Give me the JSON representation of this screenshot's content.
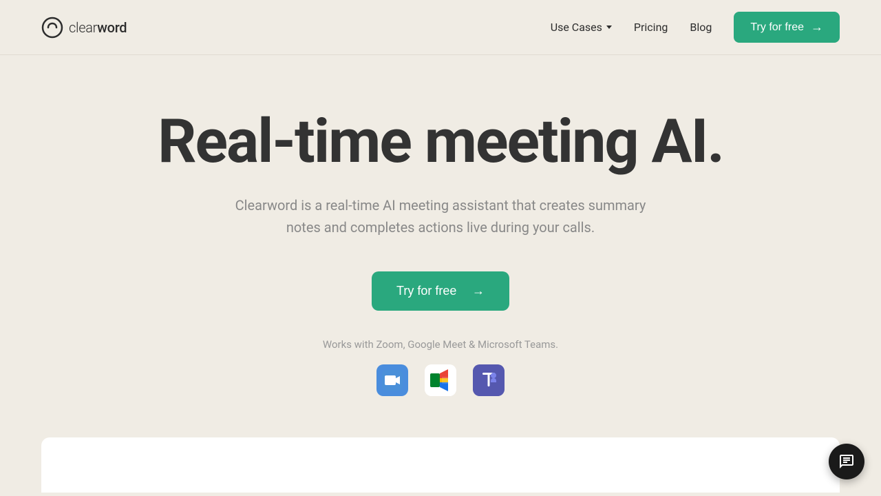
{
  "header": {
    "logo": {
      "text_clear": "clear",
      "text_word": "word",
      "full_text": "clearword"
    },
    "nav": {
      "use_cases_label": "Use Cases",
      "pricing_label": "Pricing",
      "blog_label": "Blog"
    },
    "cta": {
      "label": "Try for free"
    }
  },
  "hero": {
    "title": "Real-time meeting AI.",
    "subtitle": "Clearword is a real-time AI meeting assistant that creates summary notes and completes actions live during your calls.",
    "cta_label": "Try for free",
    "works_with": "Works with Zoom, Google Meet & Microsoft Teams.",
    "platforms": [
      {
        "name": "zoom",
        "label": "Zoom"
      },
      {
        "name": "google-meet",
        "label": "Google Meet"
      },
      {
        "name": "microsoft-teams",
        "label": "Microsoft Teams"
      }
    ]
  },
  "chat": {
    "label": "chat"
  },
  "colors": {
    "brand_green": "#2aa87e",
    "background": "#f0ece4",
    "text_dark": "#333333",
    "text_gray": "#888888"
  }
}
